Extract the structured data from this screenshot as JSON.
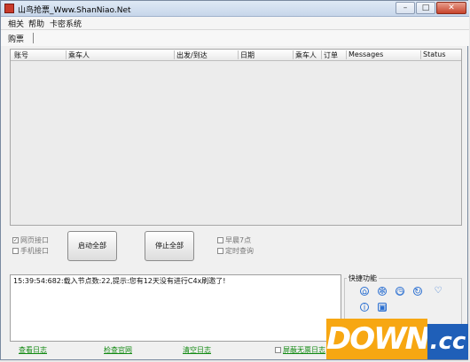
{
  "window": {
    "title": "山鸟抢票_Www.ShanNiao.Net",
    "buttons": {
      "minimize": "–",
      "maximize": "□",
      "close": "✕"
    }
  },
  "menu": [
    "相关",
    "帮助",
    "卡密系统"
  ],
  "tabs": [
    "购票"
  ],
  "table": {
    "columns": [
      "账号",
      "乘车人",
      "出发/到达",
      "日期",
      "乘车人",
      "订单",
      "Messages",
      "Status"
    ]
  },
  "controls": {
    "check_web": "网页接口",
    "check_mobile": "手机接口",
    "start_all": "启动全部",
    "stop_all": "停止全部",
    "check_early": "早晨7点",
    "check_timed": "定时查询"
  },
  "log": {
    "line": "15:39:54:682:载入节点数:22,提示:您有12天没有进行C4x刷邀了!"
  },
  "quick": {
    "label": "快捷功能"
  },
  "bottom": {
    "view_log": "查看日志",
    "check_site": "检查官网",
    "clear_log": "清空日志",
    "hide_invalid": "屏蔽无票日志"
  },
  "watermark": {
    "main": "DOWN",
    "suffix": ".cc"
  },
  "colors": {
    "accent_blue": "#2a6fd1",
    "link_green": "#138a13",
    "wm_orange": "#f7a712",
    "wm_blue": "#1f5fb8"
  },
  "quick_icons": [
    "home-icon",
    "gear-icon",
    "clock-icon",
    "refresh-icon",
    "heart-icon",
    "info-icon",
    "image-icon"
  ]
}
